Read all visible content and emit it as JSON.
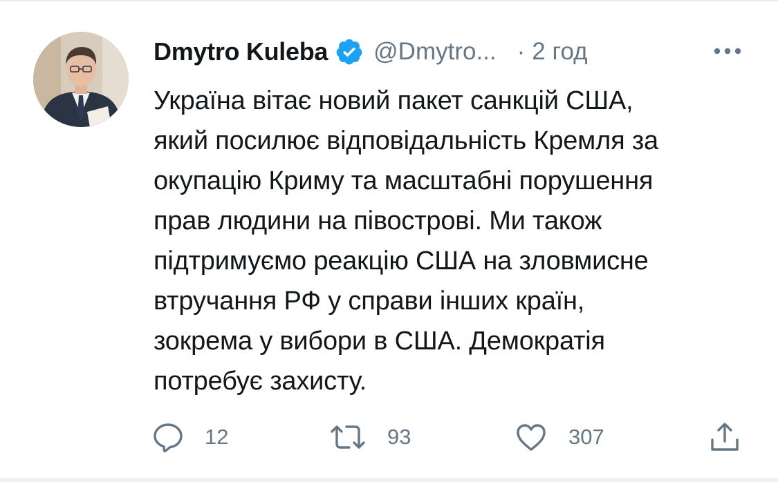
{
  "tweet": {
    "author_name": "Dmytro Kuleba",
    "author_handle": "@Dmytro...",
    "separator": "·",
    "timestamp": "2 год",
    "text_lines": [
      "Україна вітає новий пакет санкцій США,",
      "який посилює відповідальність Кремля за",
      "окупацію Криму та масштабні порушення",
      "прав людини на півострові. Ми також",
      "підтримуємо реакцію США на зловмисне",
      "втручання РФ у справи інших країн,",
      "зокрема у вибори в США. Демократія",
      "потребує захисту."
    ]
  },
  "actions": {
    "replies": "12",
    "retweets": "93",
    "likes": "307"
  },
  "icons": {
    "avatar": "avatar",
    "verified": "verified-badge-icon",
    "more": "more-options-icon",
    "reply": "reply-icon",
    "retweet": "retweet-icon",
    "like": "heart-icon",
    "share": "share-icon"
  },
  "colors": {
    "text": "#14171a",
    "secondary": "#657786",
    "verified_blue": "#1da1f2"
  }
}
